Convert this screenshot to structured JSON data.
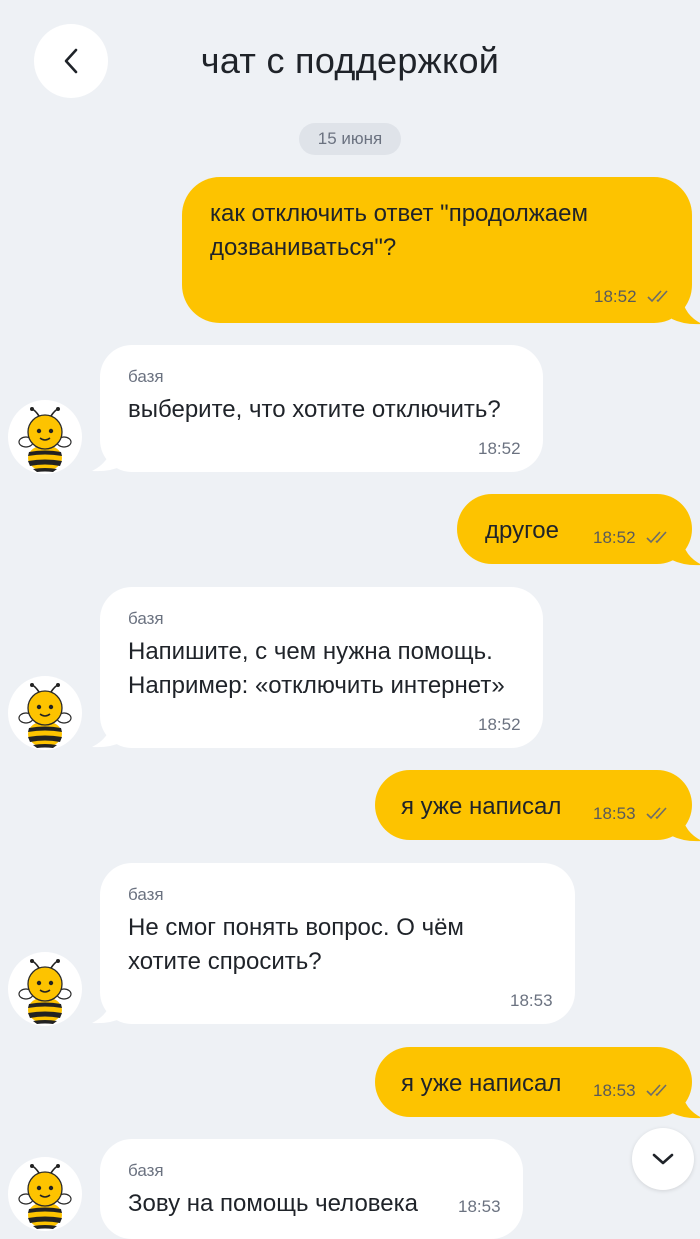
{
  "header": {
    "title": "чат с поддержкой",
    "back_icon": "chevron-left-icon"
  },
  "date_separator": "15 июня",
  "messages": [
    {
      "dir": "out",
      "text": "как отключить ответ \"продолжаем\nдозваниваться\"?",
      "time": "18:52",
      "status": "read"
    },
    {
      "dir": "in",
      "sender": "базя",
      "text": "выберите, что хотите отключить?",
      "time": "18:52"
    },
    {
      "dir": "out",
      "text": "другое",
      "time": "18:52",
      "status": "read"
    },
    {
      "dir": "in",
      "sender": "базя",
      "text": "Напишите, с чем нужна помощь.\nНапример: «отключить интернет»",
      "time": "18:52"
    },
    {
      "dir": "out",
      "text": "я уже написал",
      "time": "18:53",
      "status": "read"
    },
    {
      "dir": "in",
      "sender": "базя",
      "text": "Не смог понять вопрос. О чём\nхотите спросить?",
      "time": "18:53"
    },
    {
      "dir": "out",
      "text": "я уже написал",
      "time": "18:53",
      "status": "read"
    },
    {
      "dir": "in",
      "sender": "базя",
      "text": "Зову на помощь человека",
      "time": "18:53"
    }
  ],
  "scroll_down_icon": "chevron-down-icon",
  "colors": {
    "background": "#eef1f5",
    "outgoing": "#fdc300",
    "incoming": "#ffffff"
  }
}
